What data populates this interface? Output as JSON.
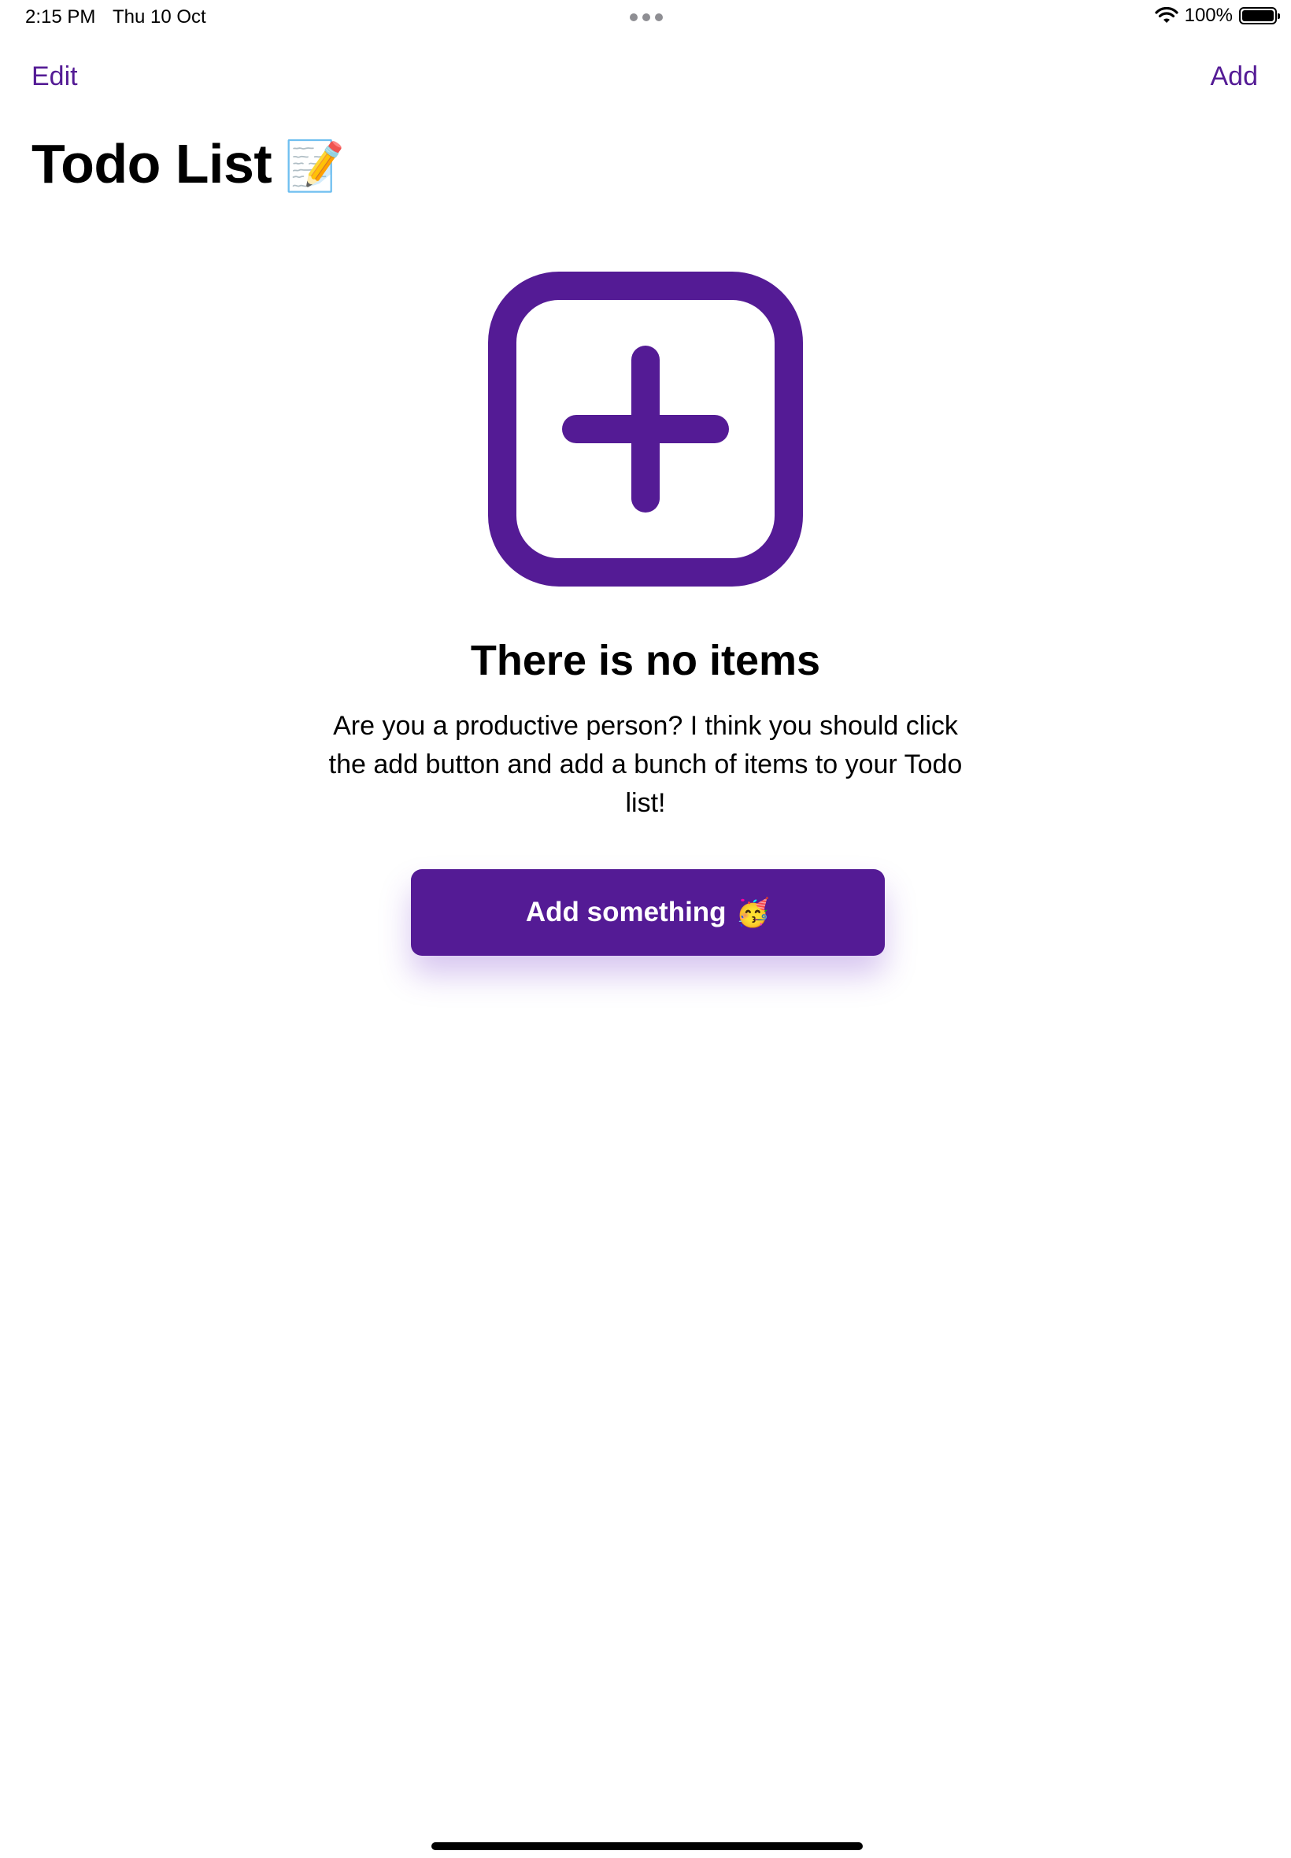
{
  "status_bar": {
    "time": "2:15 PM",
    "date": "Thu 10 Oct",
    "battery": "100%",
    "icons": [
      "wifi-icon",
      "battery-icon",
      "multitask-dots-icon"
    ]
  },
  "nav": {
    "edit_label": "Edit",
    "add_label": "Add"
  },
  "page": {
    "title": "Todo List",
    "title_emoji": "📝"
  },
  "empty_state": {
    "icon": "plus-square-icon",
    "heading": "There is no items",
    "message": "Are you a productive person? I think you should click the add button and add a bunch of items to your Todo list!",
    "button_label": "Add something",
    "button_emoji": "🥳"
  },
  "colors": {
    "accent": "#541b95",
    "background": "#ffffff",
    "text": "#000000"
  }
}
